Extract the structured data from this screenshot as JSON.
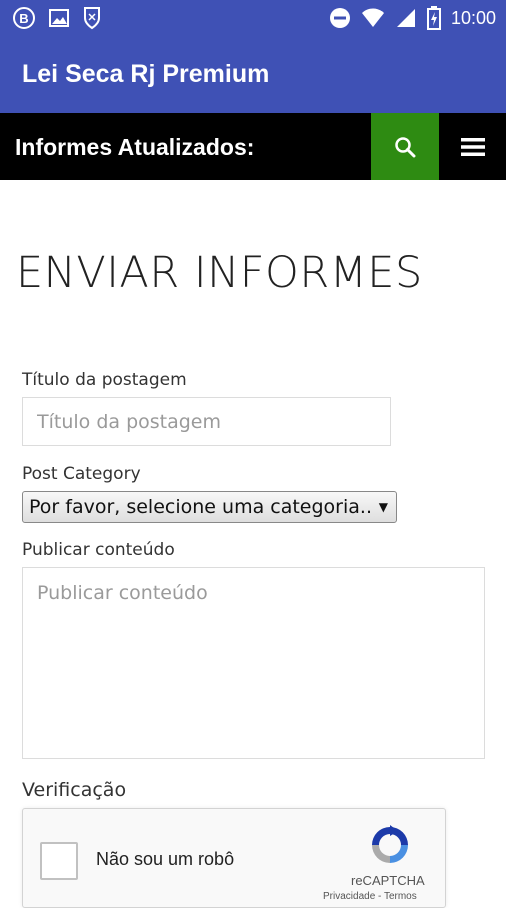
{
  "status_bar": {
    "time": "10:00",
    "left_icons": [
      "b-notification-icon",
      "image-notification-icon",
      "shield-notification-icon"
    ],
    "right_icons": [
      "do-not-disturb-icon",
      "wifi-icon",
      "signal-icon",
      "battery-charging-icon"
    ]
  },
  "app_bar": {
    "title": "Lei Seca Rj Premium",
    "color": "#3f51b5"
  },
  "site_header": {
    "title": "Informes Atualizados:",
    "search_icon": "search-icon",
    "menu_icon": "hamburger-menu-icon",
    "search_color": "#2e8b12"
  },
  "page": {
    "heading": "ENVIAR INFORMES",
    "post_title": {
      "label": "Título da postagem",
      "placeholder": "Título da postagem",
      "value": ""
    },
    "category": {
      "label": "Post Category",
      "selected": "Por favor, selecione uma categoria.."
    },
    "content": {
      "label": "Publicar conteúdo",
      "placeholder": "Publicar conteúdo",
      "value": ""
    },
    "verification": {
      "label": "Verificação",
      "checkbox_text": "Não sou um robô",
      "brand": "reCAPTCHA",
      "links": "Privacidade - Termos"
    }
  }
}
